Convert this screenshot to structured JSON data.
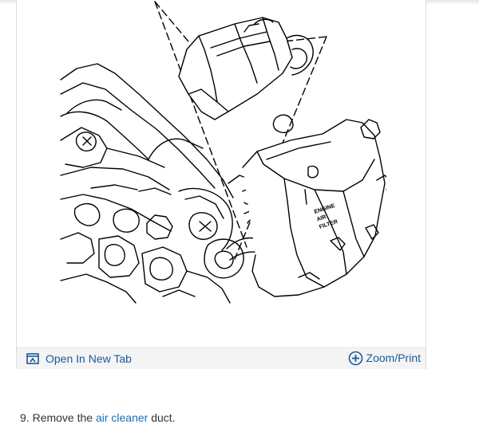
{
  "figure": {
    "footer": {
      "open_tab_label": "Open In New Tab",
      "zoom_label": "Zoom/Print"
    },
    "diagram_labels": {
      "right_housing_text": [
        "ENGINE",
        "AIR",
        "FILTER"
      ]
    }
  },
  "instruction": {
    "step_number": "9.",
    "text_before": "Remove the",
    "link_text": "air cleaner",
    "text_after": "duct."
  },
  "colors": {
    "link": "#1a6fb5",
    "footer_bg": "#f4f4f4",
    "border": "#dcdcdc",
    "body_text": "#333333"
  }
}
